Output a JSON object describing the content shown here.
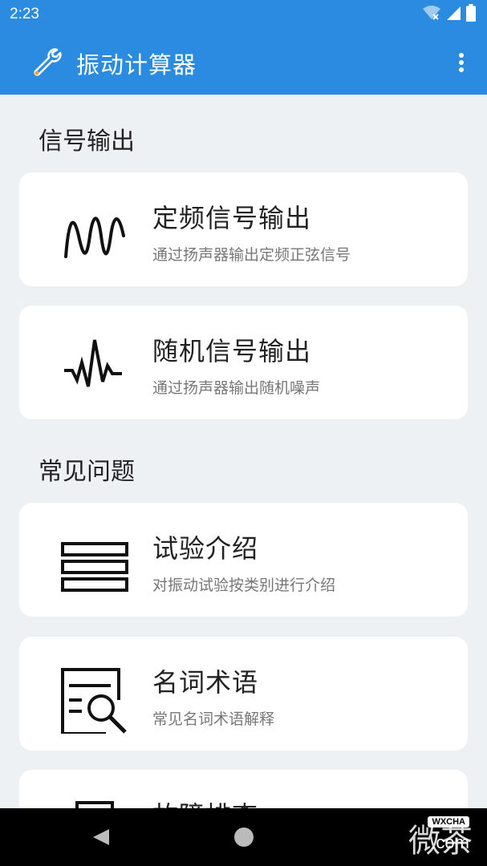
{
  "status_bar": {
    "time": "2:23",
    "icons": [
      "wifi-icon",
      "signal-icon",
      "battery-icon"
    ]
  },
  "app_bar": {
    "title": "振动计算器",
    "app_icon": "wrench-icon",
    "menu_icon": "more-vert-icon"
  },
  "sections": [
    {
      "title": "信号输出",
      "cards": [
        {
          "title": "定频信号输出",
          "desc": "通过扬声器输出定频正弦信号",
          "icon": "sine-wave-icon"
        },
        {
          "title": "随机信号输出",
          "desc": "通过扬声器输出随机噪声",
          "icon": "random-signal-icon"
        }
      ]
    },
    {
      "title": "常见问题",
      "cards": [
        {
          "title": "试验介绍",
          "desc": "对振动试验按类别进行介绍",
          "icon": "list-icon"
        },
        {
          "title": "名词术语",
          "desc": "常见名词术语解释",
          "icon": "search-document-icon"
        },
        {
          "title": "故障排查",
          "desc": "",
          "icon": "document-icon"
        }
      ]
    }
  ],
  "nav_bar": {
    "icons": [
      "back-icon",
      "home-icon"
    ]
  },
  "watermark": {
    "text": "微茶",
    "badge": "WXCHA",
    "domain": ".com"
  },
  "colors": {
    "primary": "#2a8be0",
    "background": "#eef1f4",
    "card": "#ffffff",
    "nav_bar": "#000000"
  }
}
